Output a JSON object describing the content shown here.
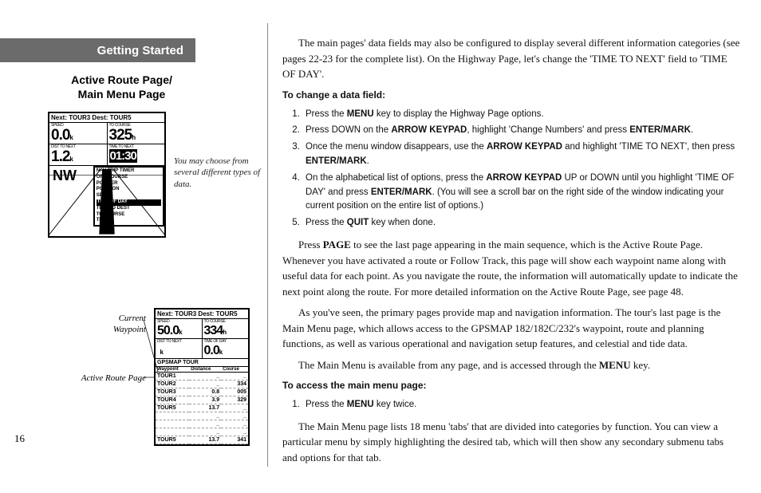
{
  "section_header": "Getting Started",
  "subsection_title": "Active Route Page/\nMain Menu Page",
  "page_number": "16",
  "fig1": {
    "header": "Next: TOUR3 Dest: TOUR5",
    "cells": [
      {
        "label": "SPEED",
        "value": "0.0",
        "unit": "k"
      },
      {
        "label": "TO COURSE",
        "value": "325",
        "unit": "h"
      },
      {
        "label": "DIST TO NEXT",
        "value": "1.2",
        "unit": "k"
      },
      {
        "label": "TIME TO NEXT",
        "time": "01:30"
      }
    ],
    "direction": "NW",
    "menu_items": [
      "NAV TRIP TIMER",
      "OFF COURSE",
      "POINTER",
      "POSITION",
      "SPEED",
      "TIME OF DAY",
      "TIME TO DEST",
      "TO COURSE",
      "TRACK"
    ],
    "caption": "You may choose from several different types of data."
  },
  "fig2": {
    "header": "Next: TOUR3 Dest: TOUR5",
    "cells": [
      {
        "label": "SPEED",
        "value": "50.0",
        "unit": "k"
      },
      {
        "label": "TO COURSE",
        "value": "334",
        "unit": "h"
      },
      {
        "label": "DIST TO NEXT",
        "value": "",
        "unit": "k"
      },
      {
        "label": "TIME OF DAY",
        "value": "0.0",
        "unit": "k"
      }
    ],
    "route_title": "GPSMAP TOUR",
    "columns": [
      "Waypoint",
      "Distance",
      "Course"
    ],
    "rows": [
      {
        "wp": "TOUR1",
        "dist": "",
        "crs": ""
      },
      {
        "wp": "TOUR2",
        "dist": "",
        "crs": "334"
      },
      {
        "wp": "TOUR3",
        "dist": "0.8",
        "crs": "005"
      },
      {
        "wp": "TOUR4",
        "dist": "3.9",
        "crs": "329"
      },
      {
        "wp": "TOUR5",
        "dist": "13.7",
        "crs": ""
      },
      {
        "wp": "",
        "dist": "",
        "crs": ""
      },
      {
        "wp": "",
        "dist": "",
        "crs": ""
      },
      {
        "wp": "",
        "dist": "",
        "crs": ""
      },
      {
        "wp": "TOUR5",
        "dist": "13.7",
        "crs": "341"
      }
    ],
    "label_current": "Current Waypoint",
    "label_page": "Active Route Page"
  },
  "body": {
    "p1_a": "The main pages' data fields may also be configured to display several different information categories (see pages 22-23 for the complete list). On the Highway Page, let's change the 'TIME TO NEXT' field to 'TIME OF DAY'.",
    "instr1_head": "To change a data field:",
    "steps1": [
      "Press the <b>MENU</b> key to display the Highway Page options.",
      "Press DOWN on the <b>ARROW KEYPAD</b>, highlight 'Change Numbers' and press <b>ENTER/MARK</b>.",
      "Once the menu window disappears, use the <b>ARROW KEYPAD</b> and highlight 'TIME TO NEXT', then press <b>ENTER/MARK</b>.",
      "On the alphabetical list of options, press the <b>ARROW KEYPAD</b> UP or DOWN until you highlight 'TIME OF DAY' and press <b>ENTER/MARK</b>. (You will see a scroll bar on the right side of the window indicating your current position on the entire list of options.)",
      "Press the <b>QUIT</b> key when done."
    ],
    "p2": "Press <b>PAGE</b> to see the last page appearing in the main sequence, which is the Active Route Page. Whenever you have activated a route or Follow Track, this page will show each waypoint name along with useful data for each point. As you navigate the route, the information will automatically update to indicate the next point along the route. For more detailed information on the Active Route Page, see page 48.",
    "p3": "As you've seen, the primary pages provide map and navigation information. The tour's last page is the Main Menu page, which allows access to the GPSMAP 182/182C/232's waypoint, route and planning functions, as well as various operational and navigation setup features, and celestial and tide data.",
    "p4": "The Main Menu is available from any page, and is accessed through the <b>MENU</b> key.",
    "instr2_head": "To access the main menu page:",
    "steps2": [
      "Press the <b>MENU</b> key twice."
    ],
    "p5": "The Main Menu page lists 18 menu 'tabs' that are divided into categories by function. You can view a particular menu by simply highlighting the desired tab, which will then show any secondary submenu tabs and options for that tab."
  }
}
